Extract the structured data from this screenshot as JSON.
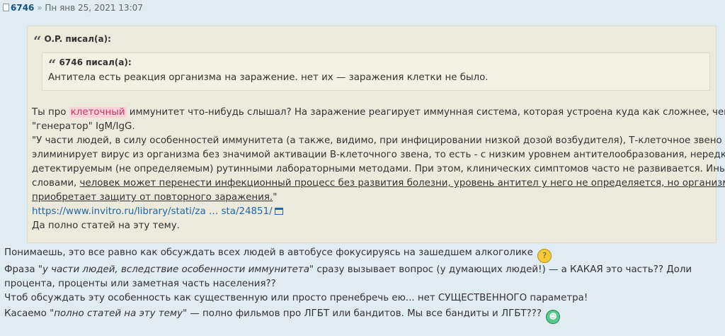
{
  "post": {
    "author": "6746",
    "separator": "»",
    "date": "Пн янв 25, 2021 13:07"
  },
  "outer_quote": {
    "author_label": "O.P. писал(а):",
    "inner_quote": {
      "author_label": "6746 писал(а):",
      "text": "Антитела есть реакция организма на заражение. нет их — заражения клетки не было."
    },
    "p1_a": "Ты про ",
    "p1_highlight": "клеточный",
    "p1_b": " иммунитет что-нибудь слышал? На заражение реагирует иммунная система, которая устроена куда как сложнее, чем",
    "p2": "\"генератор\" IgM/IgG.",
    "p3": "\"У части людей, в силу особенностей иммунитета (а также, видимо, при инфицировании низкой дозой возбудителя), Т-клеточное звено",
    "p4": "элиминирует вирус из организма без значимой активации В-клеточного звена, то есть - с низким уровнем антителообразования, нередко не",
    "p5": "детектируемым (не определяемым) рутинными лабораторными методами. При этом, клинических симптомов часто не развивается. Иными",
    "p6_a": "словами, ",
    "p6_u": "человек может перенести инфекционный процесс без развития болезни, уровень антител у него не определяется, но организм",
    "p7_u": "приобретает защиту от повторного заражения.",
    "p7_b": "\"",
    "link_text": "https://www.invitro.ru/library/stati/za … sta/24851/",
    "p9": "Да полно статей на эту тему."
  },
  "reply": {
    "l1": "Понимаешь, это все равно как обсуждать всех людей в автобусе фокусируясь на зашедшем алкоголике",
    "l2_a": "Фраза \"",
    "l2_em": "у части людей, вследствие особенности иммунитета",
    "l2_b": "\" сразу вызывает вопрос (у думающих людей!) — а КАКАЯ это часть?? Доли",
    "l3": "процента, проценты или заметная часть населения??",
    "l4": "Чтоб обсуждать эту особенность как существенную или просто пренебречь ею... нет СУЩЕСТВЕННОГО параметра!",
    "l5_a": "Касаемо \"",
    "l5_em": "полно статей на эту тему",
    "l5_b": "\" — полно фильмов про ЛГБТ или бандитов. Мы все бандиты и ЛГБТ???"
  },
  "icons": {
    "post_icon": "post-icon",
    "quote_icon": "quote-mark-icon",
    "external_link": "external-link-icon",
    "smiley_1": "thinking-smiley-icon",
    "smiley_2": "grin-smiley-icon"
  },
  "colors": {
    "background": "#e1ebf2",
    "quote_bg": "#ebeadd",
    "inner_quote_bg": "#f3f1e3",
    "author": "#105289",
    "link": "#2166a8",
    "highlight_bg": "#ffd2d9",
    "highlight_text": "#c2375d"
  }
}
